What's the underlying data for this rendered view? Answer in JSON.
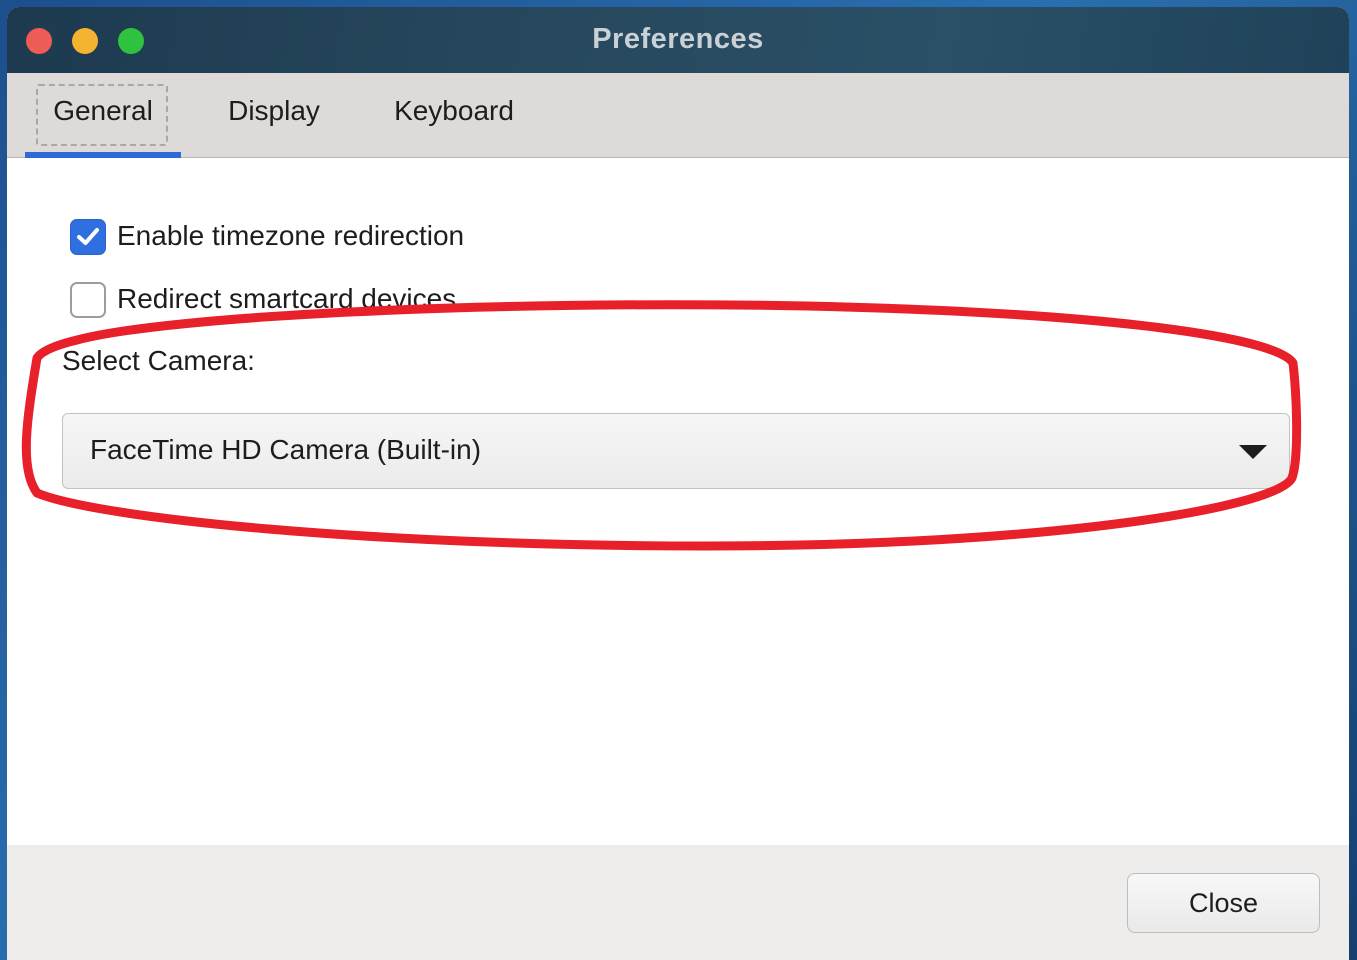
{
  "window": {
    "title": "Preferences"
  },
  "tabs": [
    {
      "label": "General",
      "selected": true
    },
    {
      "label": "Display",
      "selected": false
    },
    {
      "label": "Keyboard",
      "selected": false
    }
  ],
  "general": {
    "options": [
      {
        "label": "Enable timezone redirection",
        "checked": true
      },
      {
        "label": "Redirect smartcard devices",
        "checked": false
      }
    ],
    "camera": {
      "label": "Select Camera:",
      "selected": "FaceTime HD Camera (Built-in)"
    }
  },
  "footer": {
    "close_label": "Close"
  },
  "colors": {
    "accent": "#2f68d8",
    "annotation": "#e8202a",
    "titlebar": "#27485d"
  }
}
